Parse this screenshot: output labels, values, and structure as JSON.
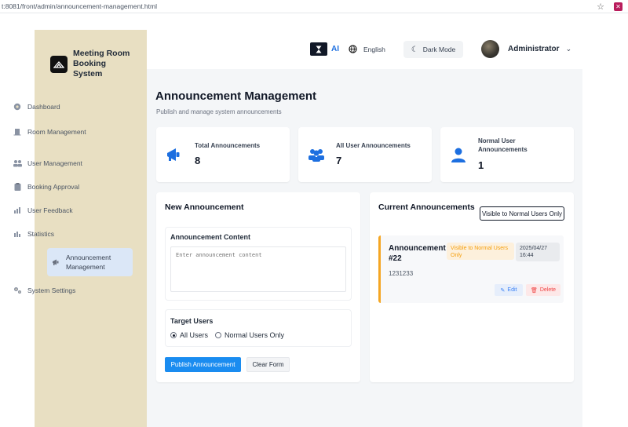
{
  "browser": {
    "url": "t:8081/front/admin/announcement-management.html"
  },
  "sidebar": {
    "brand": "Meeting Room Booking System",
    "items": [
      {
        "label": "Dashboard",
        "icon": "dashboard-icon"
      },
      {
        "label": "Room Management",
        "icon": "building-icon"
      },
      {
        "label": "User Management",
        "icon": "users-icon"
      },
      {
        "label": "Booking Approval",
        "icon": "clipboard-icon"
      },
      {
        "label": "User Feedback",
        "icon": "chart-icon"
      },
      {
        "label": "Statistics",
        "icon": "bar-chart-icon"
      },
      {
        "label": "Announcement Management",
        "icon": "megaphone-icon"
      },
      {
        "label": "System Settings",
        "icon": "gear-icon"
      }
    ],
    "active_index": 6
  },
  "header": {
    "ai_badge": "AI",
    "language": "English",
    "dark_mode": "Dark Mode",
    "user_name": "Administrator"
  },
  "page": {
    "title": "Announcement Management",
    "subtitle": "Publish and manage system announcements"
  },
  "stats": [
    {
      "label": "Total Announcements",
      "value": "8"
    },
    {
      "label": "All User Announcements",
      "value": "7"
    },
    {
      "label": "Normal User Announcements",
      "value": "1"
    }
  ],
  "new_form": {
    "title": "New Announcement",
    "content_label": "Announcement Content",
    "content_placeholder": "Enter announcement content",
    "target_label": "Target Users",
    "option_all": "All Users",
    "option_normal": "Normal Users Only",
    "publish_button": "Publish Announcement",
    "clear_button": "Clear Form"
  },
  "current": {
    "title": "Current Announcements",
    "filter_tag": "Visible to Normal Users Only",
    "announcements": [
      {
        "title": "Announcement #22",
        "badge": "Visible to Normal Users Only",
        "date": "2025/04/27 16:44",
        "body": "1231233",
        "edit": "Edit",
        "delete": "Delete"
      }
    ]
  },
  "colors": {
    "accent": "#1a8cf0",
    "sidebar_bg": "#e8dfc2",
    "warning": "#f5a623",
    "danger": "#ef4444"
  }
}
